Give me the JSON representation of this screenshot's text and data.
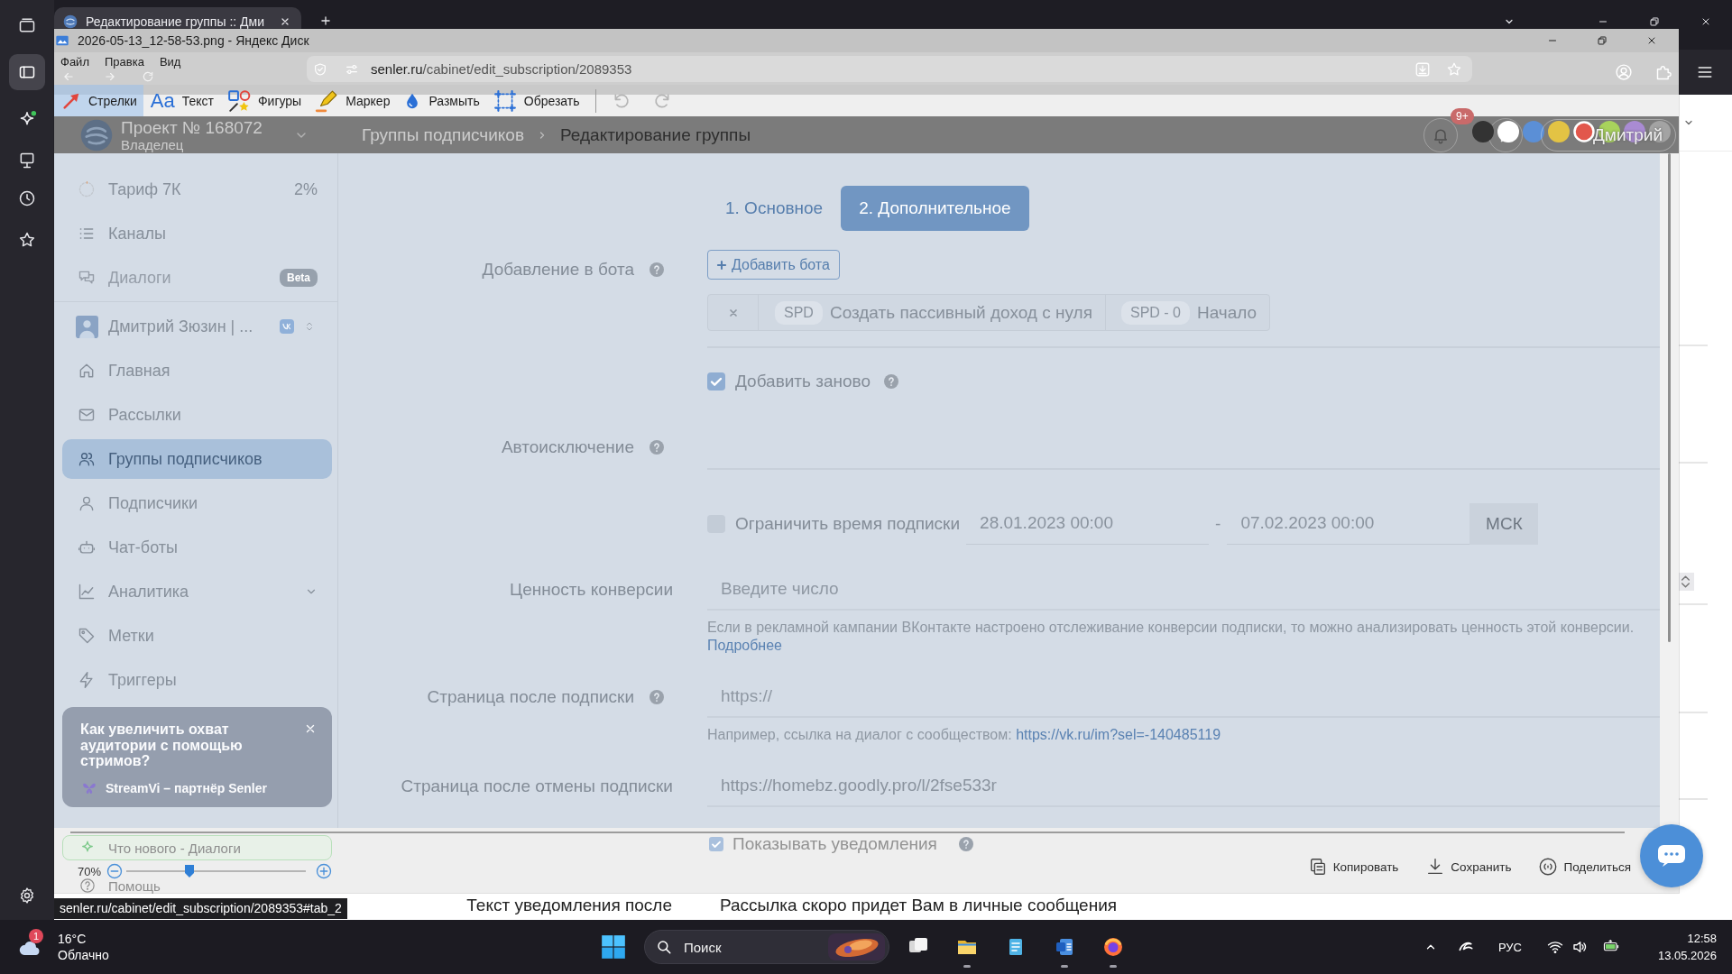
{
  "browser": {
    "tab": {
      "title": "Редактирование группы :: Дми",
      "selected": true
    },
    "address": "senler.ru/cabinet/edit_subscription/2089353",
    "status_link": "senler.ru/cabinet/edit_subscription/2089353#tab_2"
  },
  "viewer": {
    "title": "2026-05-13_12-58-53.png - Яндекс Диск",
    "menu": [
      "Файл",
      "Правка",
      "Вид"
    ],
    "tools": [
      {
        "kind": "arrow",
        "label": "Стрелки",
        "selected": true
      },
      {
        "kind": "text",
        "icon_text": "Aa",
        "label": "Текст",
        "selected": false
      },
      {
        "kind": "shapes",
        "label": "Фигуры",
        "selected": false
      },
      {
        "kind": "marker",
        "label": "Маркер",
        "selected": false
      },
      {
        "kind": "blur",
        "label": "Размыть",
        "selected": false
      },
      {
        "kind": "crop",
        "label": "Обрезать",
        "selected": false
      }
    ],
    "history": [
      {
        "kind": "undo",
        "disabled": true
      },
      {
        "kind": "redo",
        "disabled": true
      }
    ],
    "palette": [
      {
        "color": "#333333",
        "selected": false
      },
      {
        "color": "#ffffff",
        "selected": false
      },
      {
        "color": "#5b8fd6",
        "selected": false
      },
      {
        "color": "#e3c344",
        "selected": false
      },
      {
        "color": "#e2574c",
        "selected": true
      },
      {
        "color": "#a8d35c",
        "selected": false
      },
      {
        "color": "#a98bd3",
        "selected": false
      },
      {
        "color": "#a3a3a3",
        "selected": false
      }
    ],
    "zoom": {
      "reading": "70%",
      "level": 0.35
    },
    "actions": [
      {
        "kind": "copy",
        "label": "Копировать"
      },
      {
        "kind": "save",
        "label": "Сохранить"
      },
      {
        "kind": "share",
        "label": "Поделиться"
      }
    ]
  },
  "page": {
    "project": {
      "name": "Проект № 168072",
      "role": "Владелец"
    },
    "breadcrumbs": [
      {
        "label": "Группы подписчиков",
        "current": false
      },
      {
        "label": "Редактирование группы",
        "current": true
      }
    ],
    "notifications": {
      "badge": "9+"
    },
    "user": {
      "name": "Дмитрий"
    },
    "plan": {
      "label": "Тариф 7К",
      "reading": "2%",
      "level": 0.02
    },
    "top_items": [
      {
        "label": "Каналы",
        "selected": false,
        "disabled": false
      },
      {
        "label": "Диалоги",
        "badge": "Beta",
        "selected": false,
        "disabled": true
      }
    ],
    "channel": {
      "name": "Дмитрий Зюзин | ..."
    },
    "items": [
      {
        "kind": "link",
        "label": "Главная",
        "selected": false
      },
      {
        "kind": "link",
        "label": "Рассылки",
        "selected": false
      },
      {
        "kind": "link",
        "label": "Группы подписчиков",
        "selected": true
      },
      {
        "kind": "link",
        "label": "Подписчики",
        "selected": false
      },
      {
        "kind": "link",
        "label": "Чат-боты",
        "selected": false
      },
      {
        "kind": "group",
        "label": "Аналитика",
        "selected": false,
        "expanded": false
      },
      {
        "kind": "link",
        "label": "Метки",
        "selected": false
      },
      {
        "kind": "link",
        "label": "Триггеры",
        "selected": false
      }
    ],
    "promo": {
      "text": "Как увеличить охват аудитории с помощью стримов?",
      "partner": "StreamVi – партнёр Senler"
    },
    "whats_new": "Что нового - Диалоги",
    "help_link": "Помощь",
    "steps": [
      {
        "label": "1. Основное",
        "selected": false
      },
      {
        "label": "2. Дополнительное",
        "selected": true
      }
    ],
    "form": [
      {
        "kind": "bots",
        "label": "Добавление в бота",
        "help": true,
        "button": "Добавить бота",
        "bots": [
          {
            "tag": "SPD",
            "name": "Создать пассивный доход с нуля",
            "step_tag": "SPD - 0",
            "step": "Начало"
          }
        ]
      },
      {
        "kind": "checkbox",
        "label": "Добавить заново",
        "checked": true,
        "help": true
      },
      {
        "kind": "empty",
        "label": "Автоисключение",
        "help": true
      },
      {
        "kind": "period",
        "label": "Ограничить время подписки",
        "checked": false,
        "help": false,
        "from": "28.01.2023 00:00",
        "separator": "-",
        "to": "07.02.2023 00:00",
        "timezone": "МСК"
      },
      {
        "kind": "number",
        "label": "Ценность конверсии",
        "help": false,
        "placeholder": "Введите число",
        "hint": "Если в рекламной кампании ВКонтакте настроено отслеживание конверсии подписки, то можно анализировать ценность этой конверсии.",
        "more_link": "Подробнее"
      },
      {
        "kind": "input",
        "label": "Страница после подписки",
        "help": true,
        "placeholder": "https://",
        "hint": "Например, ссылка на диалог с сообществом:",
        "hint_link": "https://vk.ru/im?sel=-140485119"
      },
      {
        "kind": "input",
        "label": "Страница после отмены подписки",
        "help": false,
        "value": "https://homebz.goodly.pro/l/2fse533r"
      }
    ],
    "notify_toggle": {
      "label": "Показывать уведомления",
      "checked": true,
      "help": true
    },
    "notify_text": {
      "label": "Текст уведомления после",
      "value": "Рассылка скоро придет Вам в личные сообщения"
    }
  },
  "taskbar": {
    "weather": {
      "temperature": "16°C",
      "condition": "Облачно",
      "badge": "1"
    },
    "search": {
      "placeholder": "Поиск"
    },
    "apps": [
      {
        "kind": "task_view",
        "running": false
      },
      {
        "kind": "folder",
        "running": true
      },
      {
        "kind": "notepad",
        "running": false
      },
      {
        "kind": "document",
        "running": true
      },
      {
        "kind": "browser",
        "running": true
      }
    ],
    "tray": {
      "language": "РУС",
      "time": "12:58",
      "date": "13.05.2026"
    }
  }
}
